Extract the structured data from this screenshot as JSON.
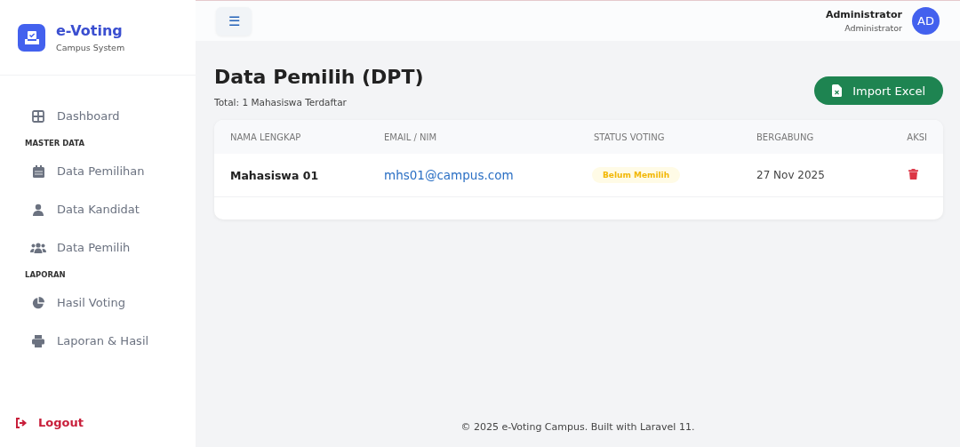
{
  "brand": {
    "title": "e-Voting",
    "subtitle": "Campus System"
  },
  "sidebar": {
    "items": [
      {
        "kind": "item",
        "label": "Dashboard"
      },
      {
        "kind": "section",
        "label": "MASTER DATA"
      },
      {
        "kind": "item",
        "label": "Data Pemilihan"
      },
      {
        "kind": "item",
        "label": "Data Kandidat"
      },
      {
        "kind": "item",
        "label": "Data Pemilih"
      },
      {
        "kind": "section",
        "label": "LAPORAN"
      },
      {
        "kind": "item",
        "label": "Hasil Voting"
      },
      {
        "kind": "item",
        "label": "Laporan & Hasil"
      }
    ],
    "logout": "Logout"
  },
  "topbar": {
    "menu_glyph": "☰",
    "user_name": "Administrator",
    "user_role": "Administrator",
    "avatar": "AD"
  },
  "page": {
    "title": "Data Pemilih (DPT)",
    "subtitle": "Total: 1 Mahasiswa Terdaftar",
    "import_button": "Import Excel"
  },
  "table": {
    "columns": [
      "NAMA LENGKAP",
      "EMAIL / NIM",
      "STATUS VOTING",
      "BERGABUNG",
      "AKSI"
    ],
    "rows": [
      {
        "name": "Mahasiswa 01",
        "email": "mhs01@campus.com",
        "status": "Belum Memilih",
        "joined": "27 Nov 2025"
      }
    ]
  },
  "footer": "© 2025 e-Voting Campus. Built with Laravel 11."
}
